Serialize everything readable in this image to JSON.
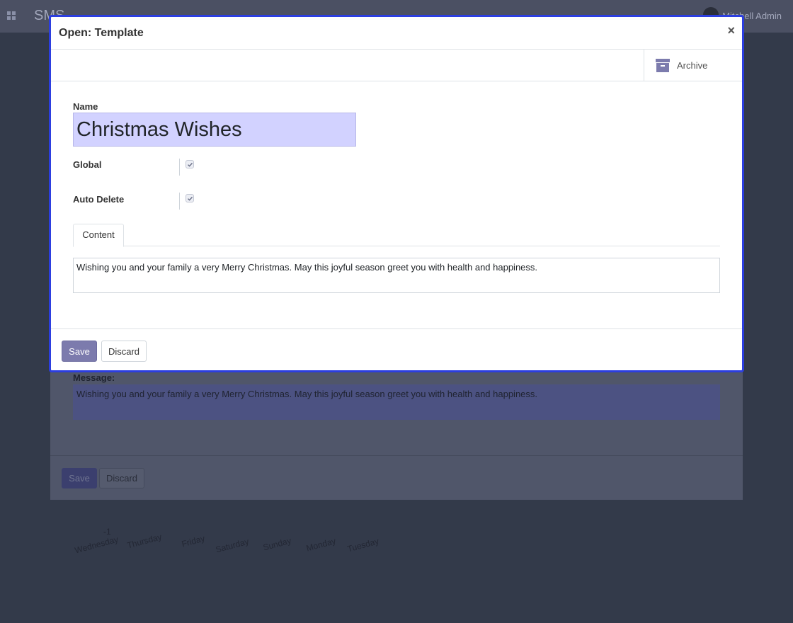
{
  "app": {
    "brand": "SMS",
    "user": "Mitchell Admin"
  },
  "background": {
    "message_label": "Message:",
    "message_text": "Wishing you and your family a very Merry Christmas. May this joyful season greet you with health and happiness.",
    "save_label": "Save",
    "discard_label": "Discard",
    "day_number": "-1",
    "days": [
      "Wednesday",
      "Thursday",
      "Friday",
      "Saturday",
      "Sunday",
      "Monday",
      "Tuesday"
    ]
  },
  "modal": {
    "title": "Open: Template",
    "close_symbol": "×",
    "archive_label": "Archive",
    "name_label": "Name",
    "name_value": "Christmas Wishes",
    "global_label": "Global",
    "global_checked": true,
    "auto_delete_label": "Auto Delete",
    "auto_delete_checked": true,
    "tabs": [
      {
        "label": "Content"
      }
    ],
    "content_text": "Wishing you and your family a very Merry Christmas. May this joyful season greet you with health and happiness.",
    "save_label": "Save",
    "discard_label": "Discard"
  },
  "colors": {
    "primary": "#7c7bad",
    "modal_border": "#2c3ee0",
    "name_field_bg": "#d2d2ff"
  }
}
